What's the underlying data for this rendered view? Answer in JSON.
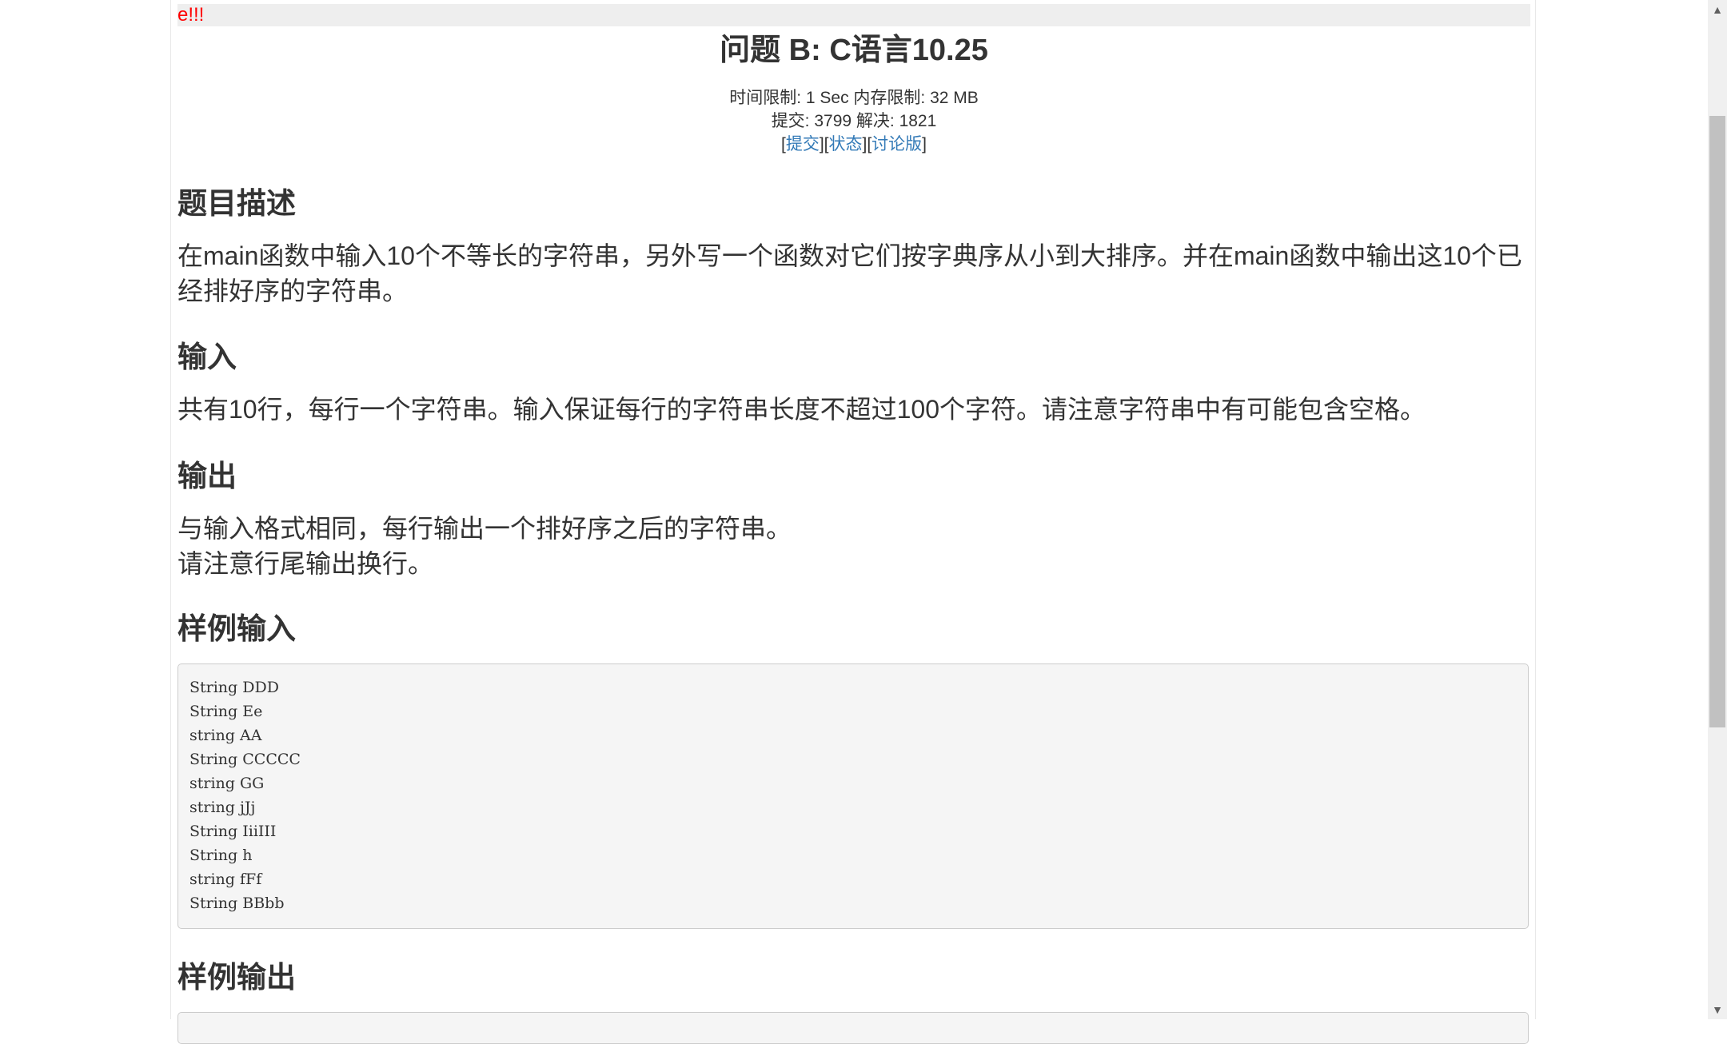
{
  "marquee": {
    "text": "e!!!"
  },
  "problem": {
    "title": "问题 B: C语言10.25",
    "meta_line1": "时间限制: 1 Sec  内存限制: 32 MB",
    "meta_line2": "提交: 3799  解决: 1821",
    "links": {
      "open": "[",
      "submit": "提交",
      "sep1": "][",
      "status": "状态",
      "sep2": "][",
      "discuss": "讨论版",
      "close": "]"
    }
  },
  "sections": {
    "description": {
      "heading": "题目描述",
      "text": "在main函数中输入10个不等长的字符串，另外写一个函数对它们按字典序从小到大排序。并在main函数中输出这10个已经排好序的字符串。"
    },
    "input": {
      "heading": "输入",
      "text": "共有10行，每行一个字符串。输入保证每行的字符串长度不超过100个字符。请注意字符串中有可能包含空格。"
    },
    "output": {
      "heading": "输出",
      "line1": "与输入格式相同，每行输出一个排好序之后的字符串。",
      "line2": "请注意行尾输出换行。"
    },
    "sample_input": {
      "heading": "样例输入",
      "lines": [
        "String DDD",
        "String Ee",
        "string AA",
        "String CCCCC",
        "string GG",
        "string jJj",
        "String IiiIII",
        "String h",
        "string fFf",
        "String BBbb"
      ]
    },
    "sample_output": {
      "heading": "样例输出"
    }
  },
  "scrollbar": {
    "up_arrow": "▲",
    "down_arrow": "▼"
  }
}
